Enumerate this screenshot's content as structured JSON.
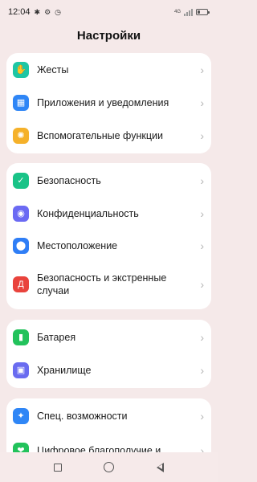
{
  "status_bar": {
    "time": "12:04",
    "icons": [
      "bluetooth-icon",
      "gear-icon",
      "alarm-icon"
    ],
    "network": "4G",
    "battery_level": 0.3
  },
  "page": {
    "title": "Настройки"
  },
  "groups": [
    {
      "items": [
        {
          "label": "Жесты",
          "icon": "hand-gesture-icon",
          "color": "#1ec6a4"
        },
        {
          "label": "Приложения и уведомления",
          "icon": "apps-icon",
          "color": "#2f86f6"
        },
        {
          "label": "Вспомогательные функции",
          "icon": "bulb-icon",
          "color": "#f5b12a"
        }
      ]
    },
    {
      "items": [
        {
          "label": "Безопасность",
          "icon": "shield-icon",
          "color": "#19c387"
        },
        {
          "label": "Конфиденциальность",
          "icon": "lock-icon",
          "color": "#6b6af3"
        },
        {
          "label": "Местоположение",
          "icon": "location-pin-icon",
          "color": "#2f7ef6"
        },
        {
          "label": "Безопасность и экстренные случаи",
          "icon": "emergency-icon",
          "color": "#e9433c"
        }
      ]
    },
    {
      "items": [
        {
          "label": "Батарея",
          "icon": "battery-icon",
          "color": "#22c25b"
        },
        {
          "label": "Хранилище",
          "icon": "storage-icon",
          "color": "#6a6cf0"
        }
      ]
    },
    {
      "items": [
        {
          "label": "Спец. возможности",
          "icon": "accessibility-icon",
          "color": "#2f86f6"
        },
        {
          "label": "Цифровое благополучие и",
          "icon": "wellbeing-icon",
          "color": "#22c25b"
        }
      ]
    }
  ],
  "nav": {
    "recents": "recents-square-icon",
    "home": "home-circle-icon",
    "back": "back-triangle-icon"
  }
}
